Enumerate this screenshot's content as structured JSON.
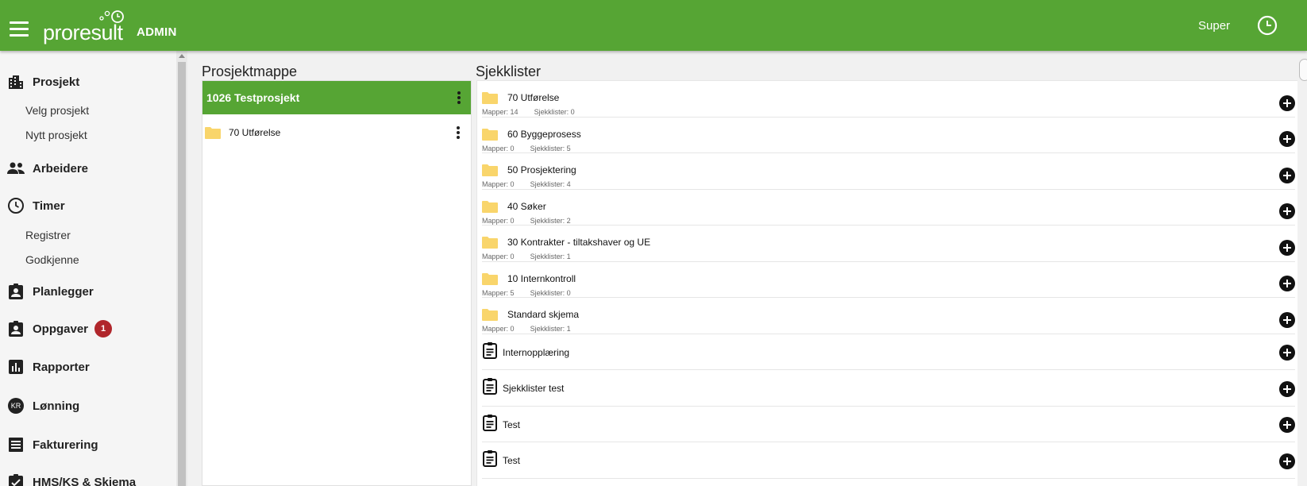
{
  "header": {
    "logo": "proresult",
    "admin_label": "ADMIN",
    "user": "Super",
    "brand_color": "#56a534"
  },
  "sidebar": {
    "sections": [
      {
        "label": "Prosjekt",
        "icon": "building-icon",
        "items": [
          "Velg prosjekt",
          "Nytt prosjekt"
        ]
      },
      {
        "label": "Arbeidere",
        "icon": "people-icon",
        "items": []
      },
      {
        "label": "Timer",
        "icon": "clock-icon",
        "items": [
          "Registrer",
          "Godkjenne"
        ]
      },
      {
        "label": "Planlegger",
        "icon": "assignment-ind-icon",
        "items": []
      },
      {
        "label": "Oppgaver",
        "icon": "assignment-ind-icon",
        "badge": "1",
        "items": []
      },
      {
        "label": "Rapporter",
        "icon": "bar-chart-icon",
        "items": []
      },
      {
        "label": "Lønning",
        "icon": "kr-icon",
        "icon_text": "KR",
        "items": []
      },
      {
        "label": "Fakturering",
        "icon": "receipt-icon",
        "items": []
      },
      {
        "label": "HMS/KS & Skjema",
        "icon": "clipboard-check-icon",
        "items": []
      }
    ]
  },
  "project_folder": {
    "title": "Prosjektmappe",
    "project": "1026 Testprosjekt",
    "folders": [
      "70 Utførelse"
    ]
  },
  "checklists": {
    "title": "Sjekklister",
    "mapper_label": "Mapper:",
    "sjekklister_label": "Sjekklister:",
    "folders": [
      {
        "name": "70 Utførelse",
        "mapper": "14",
        "sjekklister": "0"
      },
      {
        "name": "60 Byggeprosess",
        "mapper": "0",
        "sjekklister": "5"
      },
      {
        "name": "50 Prosjektering",
        "mapper": "0",
        "sjekklister": "4"
      },
      {
        "name": "40 Søker",
        "mapper": "0",
        "sjekklister": "2"
      },
      {
        "name": "30 Kontrakter - tiltakshaver og UE",
        "mapper": "0",
        "sjekklister": "1"
      },
      {
        "name": "10 Internkontroll",
        "mapper": "5",
        "sjekklister": "0"
      },
      {
        "name": "Standard skjema",
        "mapper": "0",
        "sjekklister": "1"
      }
    ],
    "lists": [
      "Internopplæring",
      "Sjekklister test",
      "Test",
      "Test"
    ]
  }
}
